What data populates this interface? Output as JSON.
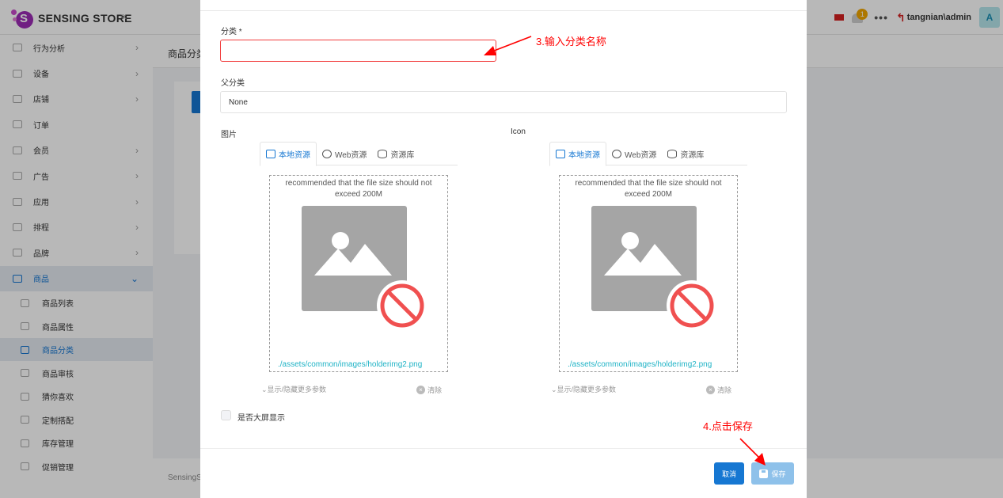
{
  "topbar": {
    "brand": "SENSING STORE",
    "collapse_icon": "double-chevron-left-icon",
    "notification_count": "1",
    "more": "•••",
    "username": "tangnian\\admin",
    "avatar_letter": "A"
  },
  "sidebar": {
    "items": [
      {
        "label": "行为分析",
        "icon": "analytics-icon",
        "chevron": "›"
      },
      {
        "label": "设备",
        "icon": "device-icon",
        "chevron": "›"
      },
      {
        "label": "店铺",
        "icon": "store-icon",
        "chevron": "›"
      },
      {
        "label": "订单",
        "icon": "order-icon",
        "chevron": ""
      },
      {
        "label": "会员",
        "icon": "member-icon",
        "chevron": "›"
      },
      {
        "label": "广告",
        "icon": "ad-icon",
        "chevron": "›"
      },
      {
        "label": "应用",
        "icon": "app-icon",
        "chevron": "›"
      },
      {
        "label": "排程",
        "icon": "schedule-icon",
        "chevron": "›"
      },
      {
        "label": "品牌",
        "icon": "brand-icon",
        "chevron": "›"
      },
      {
        "label": "商品",
        "icon": "product-icon",
        "chevron": "⌄"
      }
    ],
    "sub_items": [
      {
        "label": "商品列表",
        "icon": "product-list-icon"
      },
      {
        "label": "商品属性",
        "icon": "product-attr-icon"
      },
      {
        "label": "商品分类",
        "icon": "product-category-icon"
      },
      {
        "label": "商品审核",
        "icon": "product-review-icon"
      },
      {
        "label": "猜你喜欢",
        "icon": "heart-icon"
      },
      {
        "label": "定制搭配",
        "icon": "shirt-icon"
      },
      {
        "label": "库存管理",
        "icon": "inventory-icon"
      },
      {
        "label": "促销管理",
        "icon": "promotion-icon"
      }
    ]
  },
  "main": {
    "title": "商品分类",
    "footer": "SensingS"
  },
  "modal": {
    "category_label": "分类 *",
    "category_value": "",
    "parent_label": "父分类",
    "parent_value": "None",
    "image_label": "图片",
    "icon_label": "Icon",
    "tabs": [
      "本地资源",
      "Web资源",
      "资源库"
    ],
    "hint": "recommended that the file size should not exceed 200M",
    "path": "./assets/common/images/holderimg2.png",
    "more_params": "⌄显示/隐藏更多参数",
    "clear": "清除",
    "fullscreen_label": "是否大屏显示",
    "cancel": "取消",
    "save": "保存"
  },
  "annotations": {
    "step3": "3.输入分类名称",
    "step4": "4.点击保存"
  },
  "colors": {
    "primary": "#1677d2",
    "error_border": "#f23d3d",
    "link": "#1fb3c6",
    "annotation": "#ff0000"
  }
}
